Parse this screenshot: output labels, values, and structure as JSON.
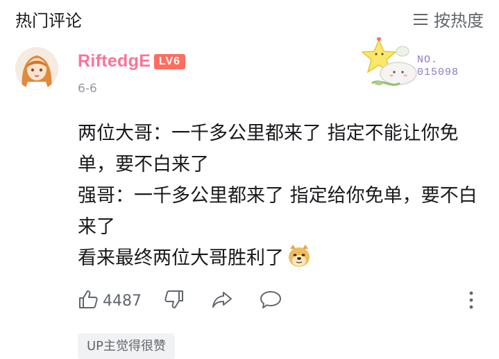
{
  "header": {
    "title": "热门评论",
    "sort_label": "按热度"
  },
  "comment": {
    "username": "RiftedgE",
    "level": "LV6",
    "date": "6-6",
    "fan_badge_number_label": "NO.",
    "fan_badge_number": "015098",
    "lines": [
      "两位大哥：一千多公里都来了 指定不能让你免单，要不白来了",
      "强哥：一千多公里都来了 指定给你免单，要不白来了",
      "看来最终两位大哥胜利了"
    ],
    "like_count": "4487",
    "up_liked_tag": "UP主觉得很赞"
  },
  "icons": {
    "sort": "sort-lines-icon",
    "like": "thumbs-up-icon",
    "dislike": "thumbs-down-icon",
    "share": "share-arrow-icon",
    "reply": "reply-bubble-icon",
    "more": "more-vertical-icon",
    "emoji": "doge-emoji-icon"
  },
  "colors": {
    "username": "#fb7299",
    "level_badge": "#ff6c60",
    "muted_text": "#9499a0",
    "icon_gray": "#61666d"
  }
}
